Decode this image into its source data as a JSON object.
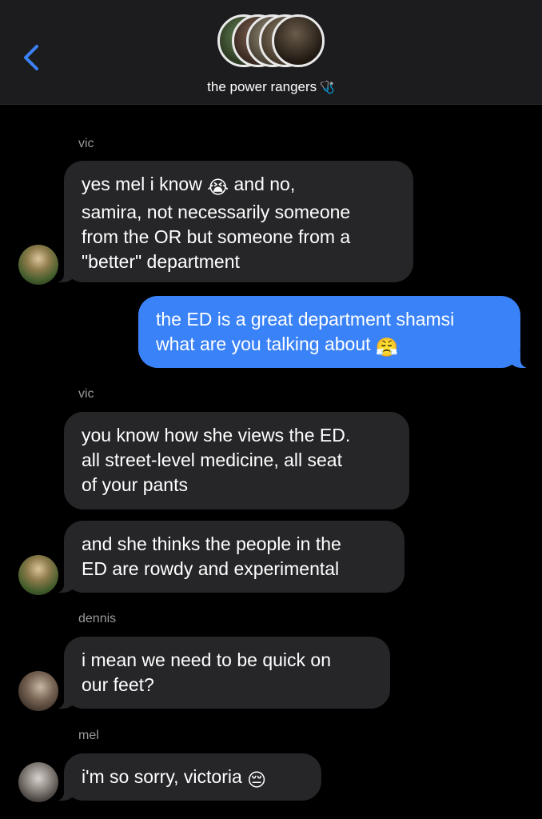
{
  "header": {
    "back_icon": "chevron-left-icon",
    "group_name": "the power rangers",
    "name_suffix_icon": "stethoscope-icon",
    "avatar_count": 5
  },
  "messages": [
    {
      "sender": "vic",
      "lines": [
        "yes mel i know [sob] and no,",
        "samira, not necessarily someone",
        "from the OR but someone from a",
        "\"better\" department"
      ]
    },
    {
      "lines": [
        "the ED is a great department shamsi",
        "what are you talking about [steam]"
      ]
    },
    {
      "sender": "vic",
      "lines": [
        "you know how she views the ED.",
        "all street-level medicine, all seat",
        "of your pants"
      ]
    },
    {
      "lines": [
        "and she thinks the people in the",
        "ED are rowdy and experimental"
      ]
    },
    {
      "sender": "dennis",
      "lines": [
        "i mean we need to be quick on",
        "our feet?"
      ]
    },
    {
      "sender": "mel",
      "lines": [
        "i'm so sorry, victoria [pensive]"
      ]
    }
  ],
  "text": {
    "m1_l1": "yes mel i know",
    "m1_l1b": "and no,",
    "m1_l2": "samira, not necessarily someone",
    "m1_l3": "from the OR but someone from a",
    "m1_l4": "\"better\" department",
    "m2_l1": "the ED is a great department shamsi",
    "m2_l2": "what are you talking about",
    "m3_l1": "you know how she views the ED.",
    "m3_l2": "all street-level medicine, all seat",
    "m3_l3": "of your pants",
    "m4_l1": "and she thinks the people in the",
    "m4_l2": "ED are rowdy and experimental",
    "m5_l1": "i mean we need to be quick on",
    "m5_l2": "our feet?",
    "m6_l1": "i'm so sorry, victoria",
    "s1": "vic",
    "s2": "vic",
    "s3": "dennis",
    "s4": "mel"
  },
  "colors": {
    "incoming_bubble": "#262629",
    "outgoing_bubble": "#3a82f7",
    "header_bg": "#1c1c1e",
    "accent": "#3a82f7"
  }
}
